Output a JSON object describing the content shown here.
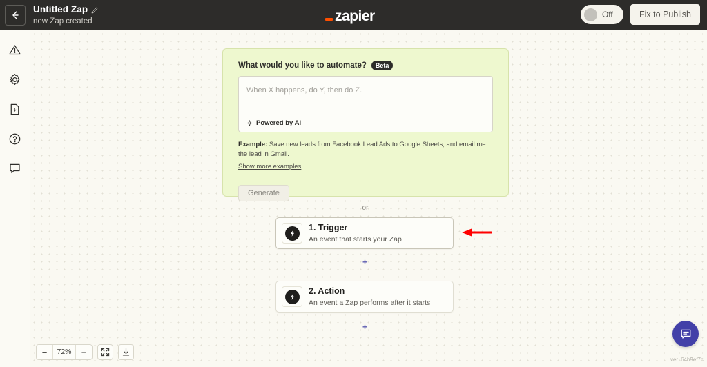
{
  "topbar": {
    "back_icon": "arrow-left-icon",
    "zap_title": "Untitled Zap",
    "edit_icon": "pencil-icon",
    "zap_subtitle": "new Zap created",
    "logo_text": "zapier",
    "logo_accent_color": "#ff4f00",
    "toggle_label": "Off",
    "toggle_state": "off",
    "publish_button": "Fix to Publish",
    "background_color": "#2d2c2a"
  },
  "sidebar": {
    "items": [
      {
        "name": "warning-icon",
        "label": "Issues"
      },
      {
        "name": "gear-icon",
        "label": "Settings"
      },
      {
        "name": "zap-history-icon",
        "label": "Zap History"
      },
      {
        "name": "help-icon",
        "label": "Help"
      },
      {
        "name": "comment-icon",
        "label": "Comments"
      }
    ]
  },
  "ai_panel": {
    "heading": "What would you like to automate?",
    "badge": "Beta",
    "textarea_placeholder": "When X happens, do Y, then do Z.",
    "textarea_value": "",
    "powered_by": "Powered by AI",
    "sparkle_icon": "sparkle-icon",
    "example_label": "Example:",
    "example_text": " Save new leads from Facebook Lead Ads to Google Sheets, and email me the lead in Gmail.",
    "show_more_link": "Show more examples",
    "generate_button": "Generate",
    "background_color": "#eef8cf"
  },
  "divider": {
    "or_text": "or"
  },
  "flow": {
    "steps": [
      {
        "title": "1. Trigger",
        "subtitle": "An event that starts your Zap",
        "icon": "bolt-icon",
        "selected": true
      },
      {
        "title": "2. Action",
        "subtitle": "An event a Zap performs after it starts",
        "icon": "bolt-icon",
        "selected": false
      }
    ],
    "add_step_symbol": "+",
    "add_step_color": "#5b5bb0"
  },
  "annotation": {
    "arrow": "red-arrow-pointing-left",
    "color": "#ff0000",
    "target": "1. Trigger"
  },
  "zoom_controls": {
    "zoom_out": "−",
    "zoom_level": "72%",
    "zoom_in": "+",
    "fit_icon": "fit-to-screen-icon",
    "download_icon": "download-icon"
  },
  "footer": {
    "chat_icon": "chat-bubble-icon",
    "chat_color": "#4240a8",
    "version": "ver. 64b9ef7c"
  }
}
